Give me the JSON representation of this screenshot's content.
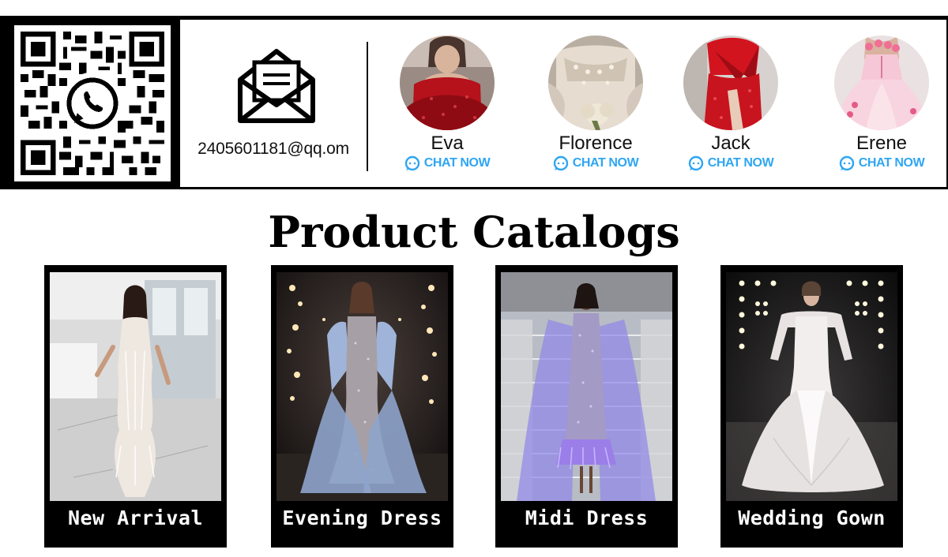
{
  "contact": {
    "qr_code_icon": "whatsapp-qr-code",
    "mail_icon": "envelope-icon",
    "email": "2405601181@qq.om"
  },
  "agents": [
    {
      "name": "Eva",
      "chat_label": "CHAT NOW",
      "dress_color": "#b5121b"
    },
    {
      "name": "Florence",
      "chat_label": "CHAT NOW",
      "dress_color": "#e6ddd0"
    },
    {
      "name": "Jack",
      "chat_label": "CHAT NOW",
      "dress_color": "#c8141e"
    },
    {
      "name": "Erene",
      "chat_label": "CHAT NOW",
      "dress_color": "#f4b8cc"
    }
  ],
  "catalog": {
    "title": "Product Catalogs",
    "items": [
      {
        "label": "New Arrival"
      },
      {
        "label": "Evening Dress"
      },
      {
        "label": "Midi Dress"
      },
      {
        "label": "Wedding Gown"
      }
    ]
  },
  "colors": {
    "chat_accent": "#2ea6f3",
    "banner_border": "#000000",
    "card_background": "#000000"
  }
}
